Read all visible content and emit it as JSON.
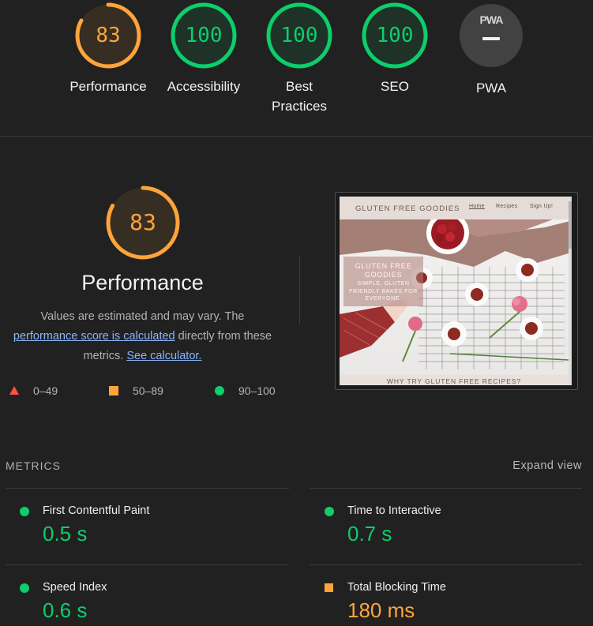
{
  "colors": {
    "pass": "#0cce6b",
    "average": "#ffa43a",
    "fail": "#ff4e42",
    "link": "#8ab4f8"
  },
  "gauges": [
    {
      "score": "83",
      "label": "Performance",
      "fraction": 0.83,
      "color": "#ffa43a"
    },
    {
      "score": "100",
      "label": "Accessibility",
      "fraction": 1.0,
      "color": "#0cce6b"
    },
    {
      "score": "100",
      "label": "Best Practices",
      "fraction": 1.0,
      "color": "#0cce6b"
    },
    {
      "score": "100",
      "label": "SEO",
      "fraction": 1.0,
      "color": "#0cce6b"
    },
    {
      "pwa_mark": "PWA",
      "label": "PWA",
      "icon": "pwa-dash-icon"
    }
  ],
  "performance": {
    "score": "83",
    "fraction": 0.83,
    "title": "Performance",
    "desc_text_1": "Values are estimated and may vary. The",
    "desc_link_1": "performance score is calculated",
    "desc_text_2": " directly from these metrics. ",
    "desc_link_2": "See calculator."
  },
  "legend": [
    {
      "shape": "triangle",
      "range": "0–49"
    },
    {
      "shape": "square",
      "range": "50–89"
    },
    {
      "shape": "circle",
      "range": "90–100"
    }
  ],
  "screenshot": {
    "brand": "GLUTEN FREE GOODIES",
    "nav_links": [
      "Home",
      "Recipes",
      "Sign Up!"
    ],
    "hero_title": "GLUTEN FREE GOODIES",
    "hero_subtitle": "SIMPLE, GLUTEN FRIENDLY BAKES FOR EVERYONE.",
    "footer_heading": "WHY TRY GLUTEN FREE RECIPES?"
  },
  "metrics": {
    "header": "METRICS",
    "expand_label": "Expand view",
    "items": [
      {
        "label": "First Contentful Paint",
        "value": "0.5 s",
        "status": "pass"
      },
      {
        "label": "Time to Interactive",
        "value": "0.7 s",
        "status": "pass"
      },
      {
        "label": "Speed Index",
        "value": "0.6 s",
        "status": "pass"
      },
      {
        "label": "Total Blocking Time",
        "value": "180 ms",
        "status": "average"
      }
    ]
  }
}
